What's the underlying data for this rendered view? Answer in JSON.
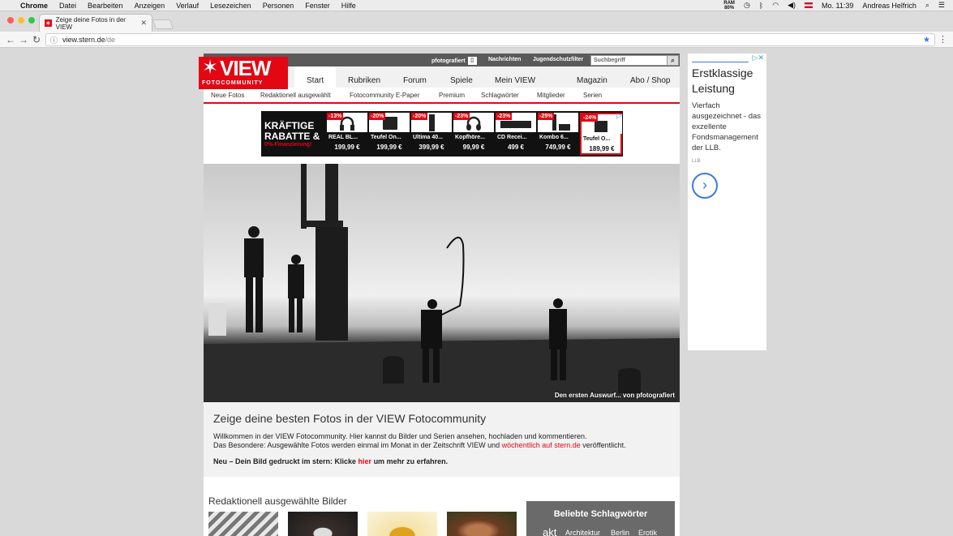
{
  "menubar": {
    "apple": "",
    "app": "Chrome",
    "items": [
      "Datei",
      "Bearbeiten",
      "Anzeigen",
      "Verlauf",
      "Lesezeichen",
      "Personen",
      "Fenster",
      "Hilfe"
    ],
    "ram_label": "RAM",
    "ram_value": "80%",
    "clock": "Mo. 11:39",
    "user": "Andreas Helfrich"
  },
  "browser": {
    "tab_title": "Zeige deine Fotos in der VIEW",
    "favicon_glyph": "✶",
    "url_host": "view.stern.de",
    "url_path": "/de"
  },
  "site": {
    "logo": {
      "mark": "✶",
      "word": "VIEW",
      "sub": "FOTOCOMMUNITY"
    },
    "topbar": {
      "fotografiert": "pfotografiert",
      "nachrichten": "Nachrichten",
      "jugendschutz": "Jugendschutzfilter",
      "search_placeholder": "Suchbegriff"
    },
    "nav": [
      "Start",
      "Rubriken",
      "Forum",
      "Spiele",
      "Mein VIEW",
      "Magazin",
      "Abo / Shop"
    ],
    "subnav": [
      "Neue Fotos",
      "Redaktionell ausgewählt",
      "Fotocommunity E-Paper",
      "Premium",
      "Schlagwörter",
      "Mitglieder",
      "Serien"
    ],
    "banner": {
      "headline_1": "KRÄFTIGE",
      "headline_2": "RABATTE &",
      "financing": "0%-Finanzierung!",
      "products": [
        {
          "discount": "-13%",
          "name": "REAL BL...",
          "price": "199,99 €"
        },
        {
          "discount": "-20%",
          "name": "Teufel On...",
          "price": "199,99 €"
        },
        {
          "discount": "-20%",
          "name": "Ultima 40...",
          "price": "399,99 €"
        },
        {
          "discount": "-23%",
          "name": "Kopfhöre...",
          "price": "99,99 €"
        },
        {
          "discount": "-23%",
          "name": "CD Recei...",
          "price": "499 €"
        },
        {
          "discount": "-25%",
          "name": "Kombo 6...",
          "price": "749,99 €"
        },
        {
          "discount": "-24%",
          "name": "Teufel O...",
          "price": "189,99 €"
        }
      ]
    },
    "hero_caption": "Den ersten Auswurf... von pfotografiert",
    "intro": {
      "title": "Zeige deine besten Fotos in der VIEW Fotocommunity",
      "line1": "Willkommen in der VIEW Fotocommunity. Hier kannst du Bilder und Serien ansehen, hochladen und kommentieren.",
      "line2_pre": "Das Besondere: Ausgewählte Fotos werden einmal im Monat in der Zeitschrift VIEW und ",
      "line2_link": "wöchentlich auf stern.de",
      "line2_post": " veröffentlicht.",
      "line3_pre": "Neu – Dein Bild gedruckt im stern: Klicke ",
      "line3_link": "hier",
      "line3_post": " um mehr zu erfahren."
    },
    "section_title": "Redaktionell ausgewählte Bilder",
    "tags": {
      "title": "Beliebte Schlagwörter",
      "words": [
        "akt",
        "Architektur",
        "Berlin",
        "Erotik"
      ]
    }
  },
  "ad": {
    "headline": "Erstklassige Leistung",
    "body": "Vierfach ausgezeichnet - das exzellente Fondsmanagement der LLB.",
    "source": "LLB"
  },
  "colors": {
    "brand": "#e30613",
    "link": "#3b78e7"
  }
}
